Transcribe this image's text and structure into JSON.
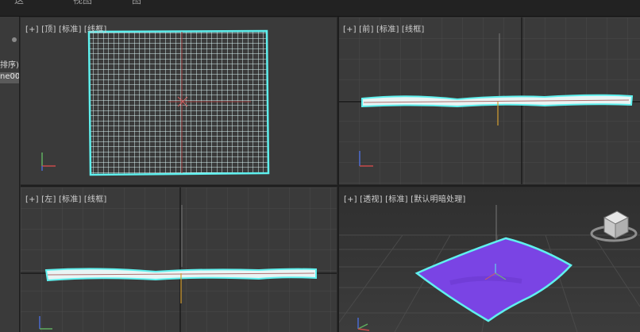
{
  "top_menu": [
    "这",
    "视图",
    "图"
  ],
  "left_panel": {
    "sort_label": "排序)",
    "selected_item": "ne00"
  },
  "viewports": {
    "top": {
      "label": "[+] [顶] [标准] [线框]"
    },
    "front": {
      "label": "[+] [前] [标准] [线框]"
    },
    "left": {
      "label": "[+] [左] [标准] [线框]"
    },
    "perspective": {
      "label": "[+] [透视] [标准] [默认明暗处理]"
    }
  },
  "colors": {
    "viewport_bg": "#3a3a3a",
    "grid": "#4a4a4a",
    "mesh_wire": "#d9f4f4",
    "mesh_highlight": "#5ff0ee",
    "cloth_fill": "#7a44e4",
    "active_border": "#d6b45a"
  },
  "icons": [
    "axis-gizmo-icon",
    "viewcube-icon",
    "pivot-icon"
  ]
}
